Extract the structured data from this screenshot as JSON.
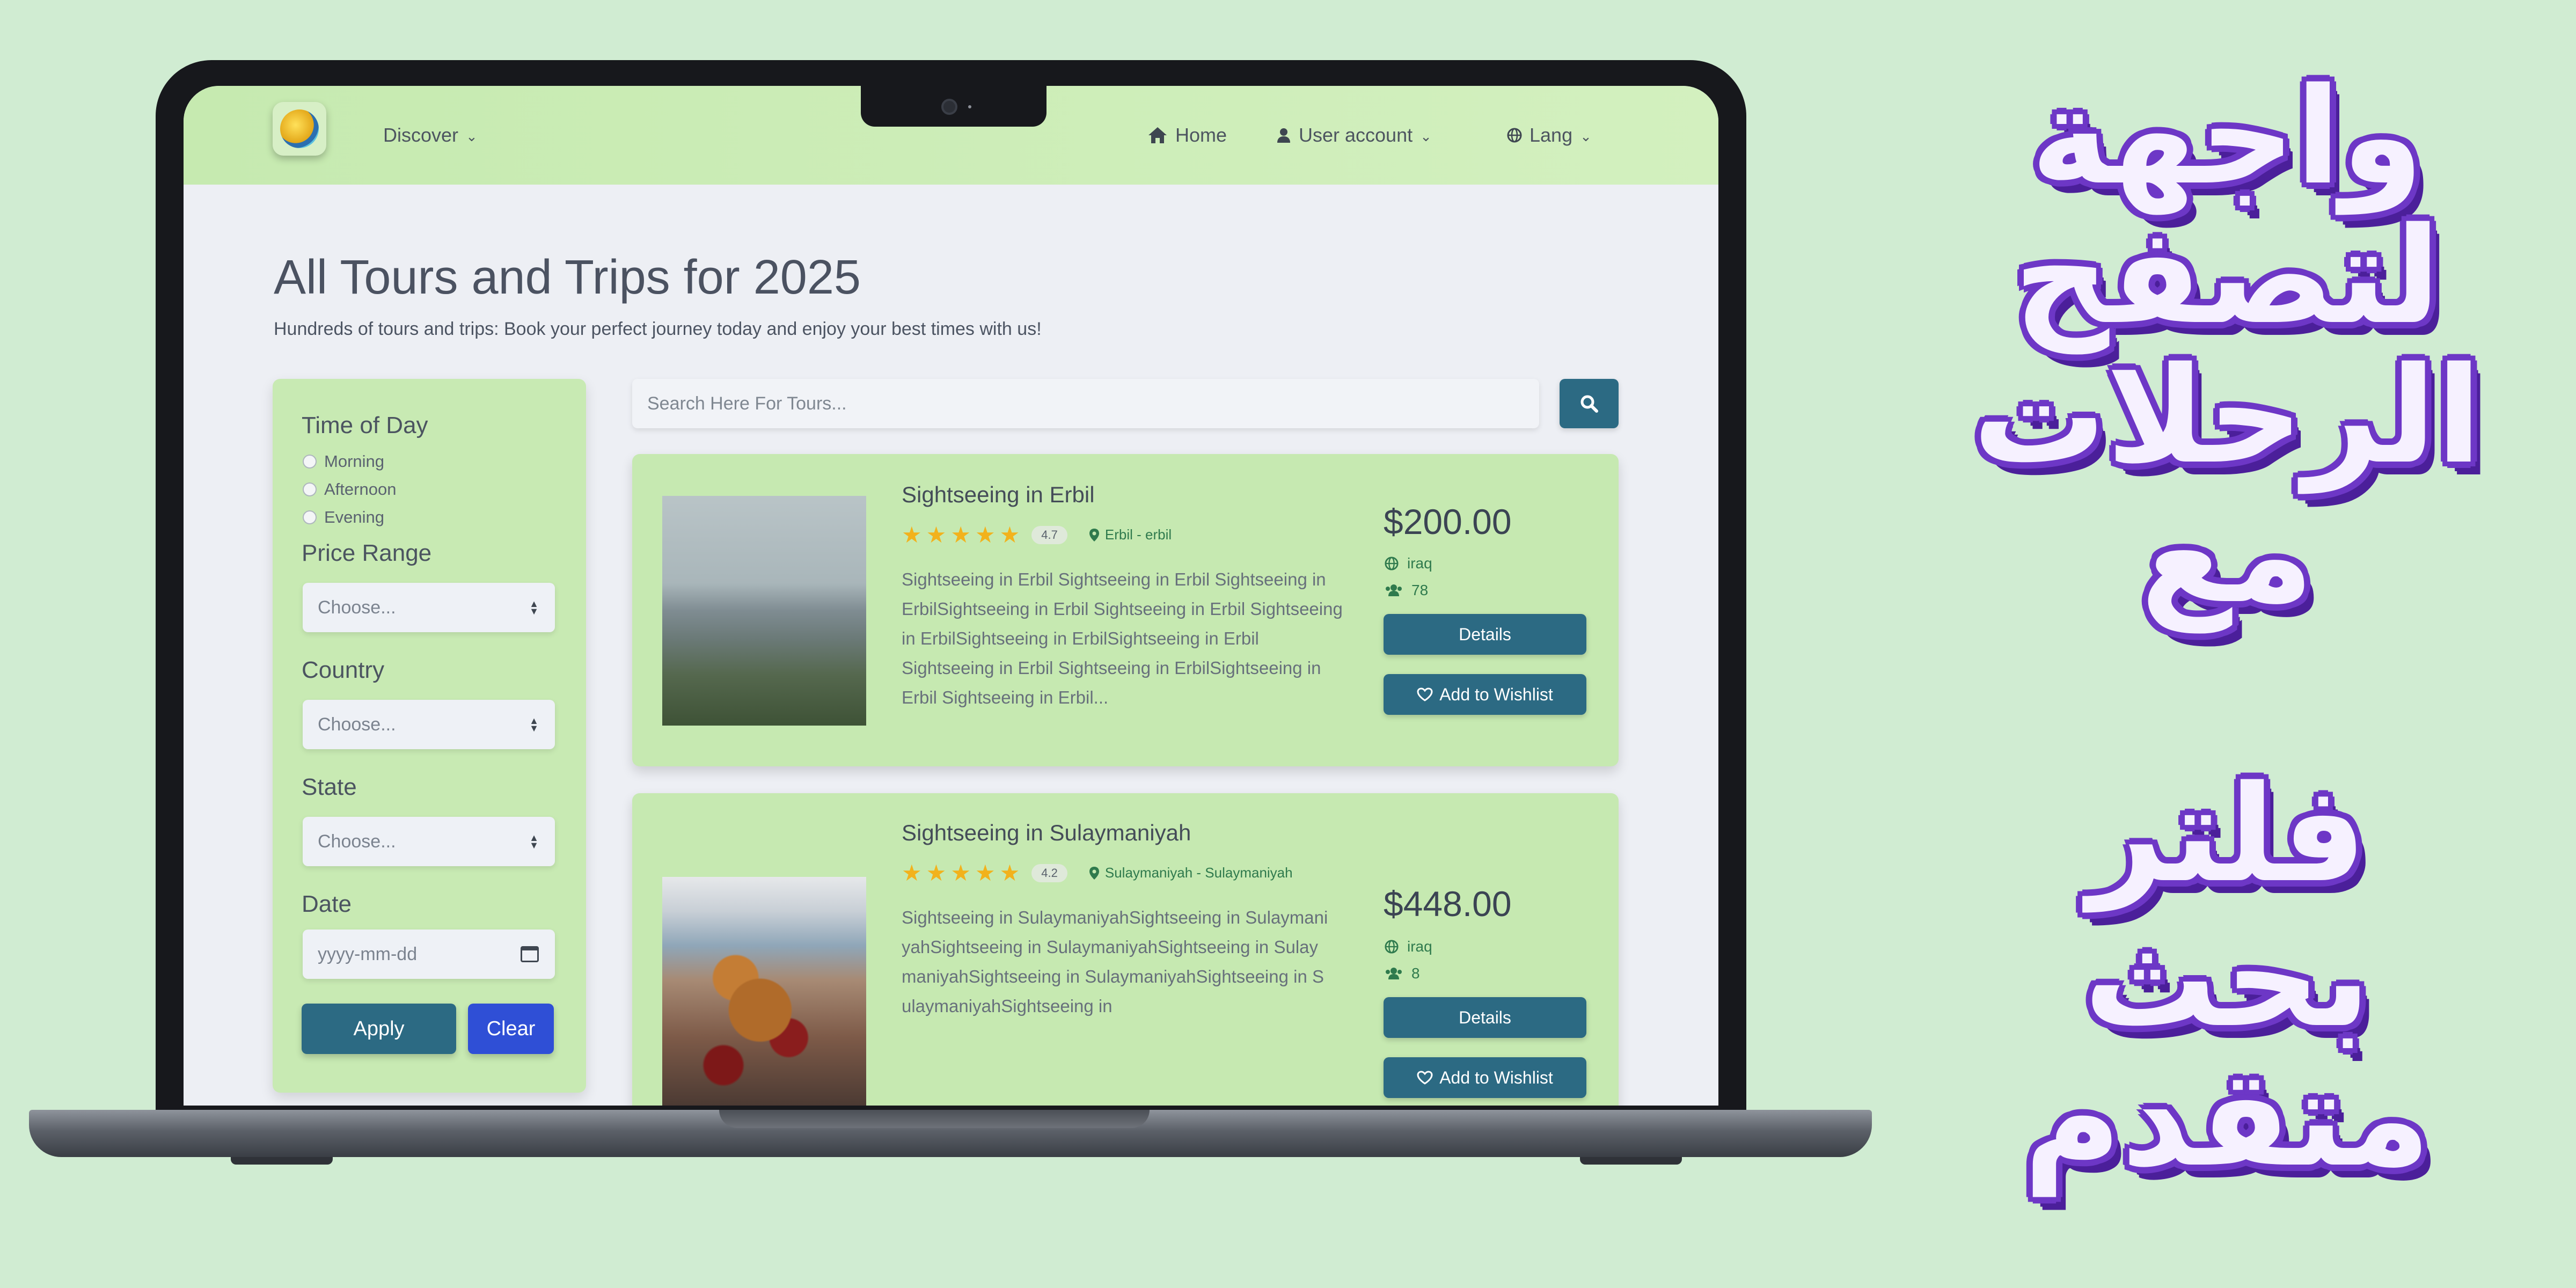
{
  "nav": {
    "discover": "Discover",
    "home": "Home",
    "user_account": "User account",
    "lang": "Lang"
  },
  "page": {
    "title": "All Tours and Trips for 2025",
    "subtitle": "Hundreds of tours and trips: Book your perfect journey today and enjoy your best times with us!"
  },
  "filters": {
    "time_of_day_label": "Time of Day",
    "time_options": [
      "Morning",
      "Afternoon",
      "Evening"
    ],
    "price_range_label": "Price Range",
    "price_placeholder": "Choose...",
    "country_label": "Country",
    "country_placeholder": "Choose...",
    "state_label": "State",
    "state_placeholder": "Choose...",
    "date_label": "Date",
    "date_placeholder": "yyyy-mm-dd",
    "apply": "Apply",
    "clear": "Clear"
  },
  "search": {
    "placeholder": "Search Here For Tours..."
  },
  "tours": [
    {
      "title": "Sightseeing in Erbil",
      "rating": "4.7",
      "location": "Erbil - erbil",
      "description": "Sightseeing in Erbil Sightseeing in Erbil Sightseeing in ErbilSightseeing in Erbil Sightseeing in Erbil Sightseeing in ErbilSightseeing in ErbilSightseeing in Erbil Sightseeing in Erbil Sightseeing in ErbilSightseeing in Erbil Sightseeing in Erbil...",
      "price": "$200.00",
      "country": "iraq",
      "count": "78",
      "details": "Details",
      "wishlist": "Add to Wishlist"
    },
    {
      "title": "Sightseeing in Sulaymaniyah",
      "rating": "4.2",
      "location": "Sulaymaniyah - Sulaymaniyah",
      "description": "Sightseeing in SulaymaniyahSightseeing in SulaymaniyahSightseeing in SulaymaniyahSightseeing in SulaymaniyahSightseeing in SulaymaniyahSightseeing in SulaymaniyahSightseeing in",
      "price": "$448.00",
      "country": "iraq",
      "count": "8",
      "details": "Details",
      "wishlist": "Add to Wishlist"
    }
  ],
  "promo": {
    "line1": "واجهة",
    "line2": "لتصفح",
    "line3": "الرحلات",
    "line4": "مع",
    "line5": "فلتر",
    "line6": "بحث",
    "line7": "متقدم"
  },
  "colors": {
    "background": "#d0ecd2",
    "navbar": "#c6eab0",
    "primary_button": "#2c6a83",
    "clear_button": "#2f4fd6",
    "star": "#f2b21c",
    "promo_outline": "#6d37c6"
  }
}
